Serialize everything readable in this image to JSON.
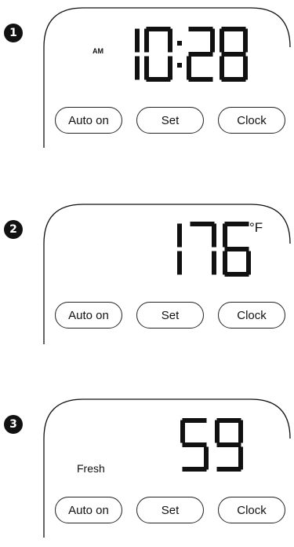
{
  "panels": [
    {
      "badge": "1",
      "display": "10:28",
      "digits": [
        "1",
        "0",
        "2",
        "8"
      ],
      "indicator": "AM",
      "buttons": [
        "Auto on",
        "Set",
        "Clock"
      ]
    },
    {
      "badge": "2",
      "display": "176",
      "digits": [
        "1",
        "7",
        "6"
      ],
      "unit": "°F",
      "buttons": [
        "Auto on",
        "Set",
        "Clock"
      ]
    },
    {
      "badge": "3",
      "display": "59",
      "digits": [
        "5",
        "9"
      ],
      "mode": "Fresh",
      "buttons": [
        "Auto on",
        "Set",
        "Clock"
      ]
    }
  ]
}
